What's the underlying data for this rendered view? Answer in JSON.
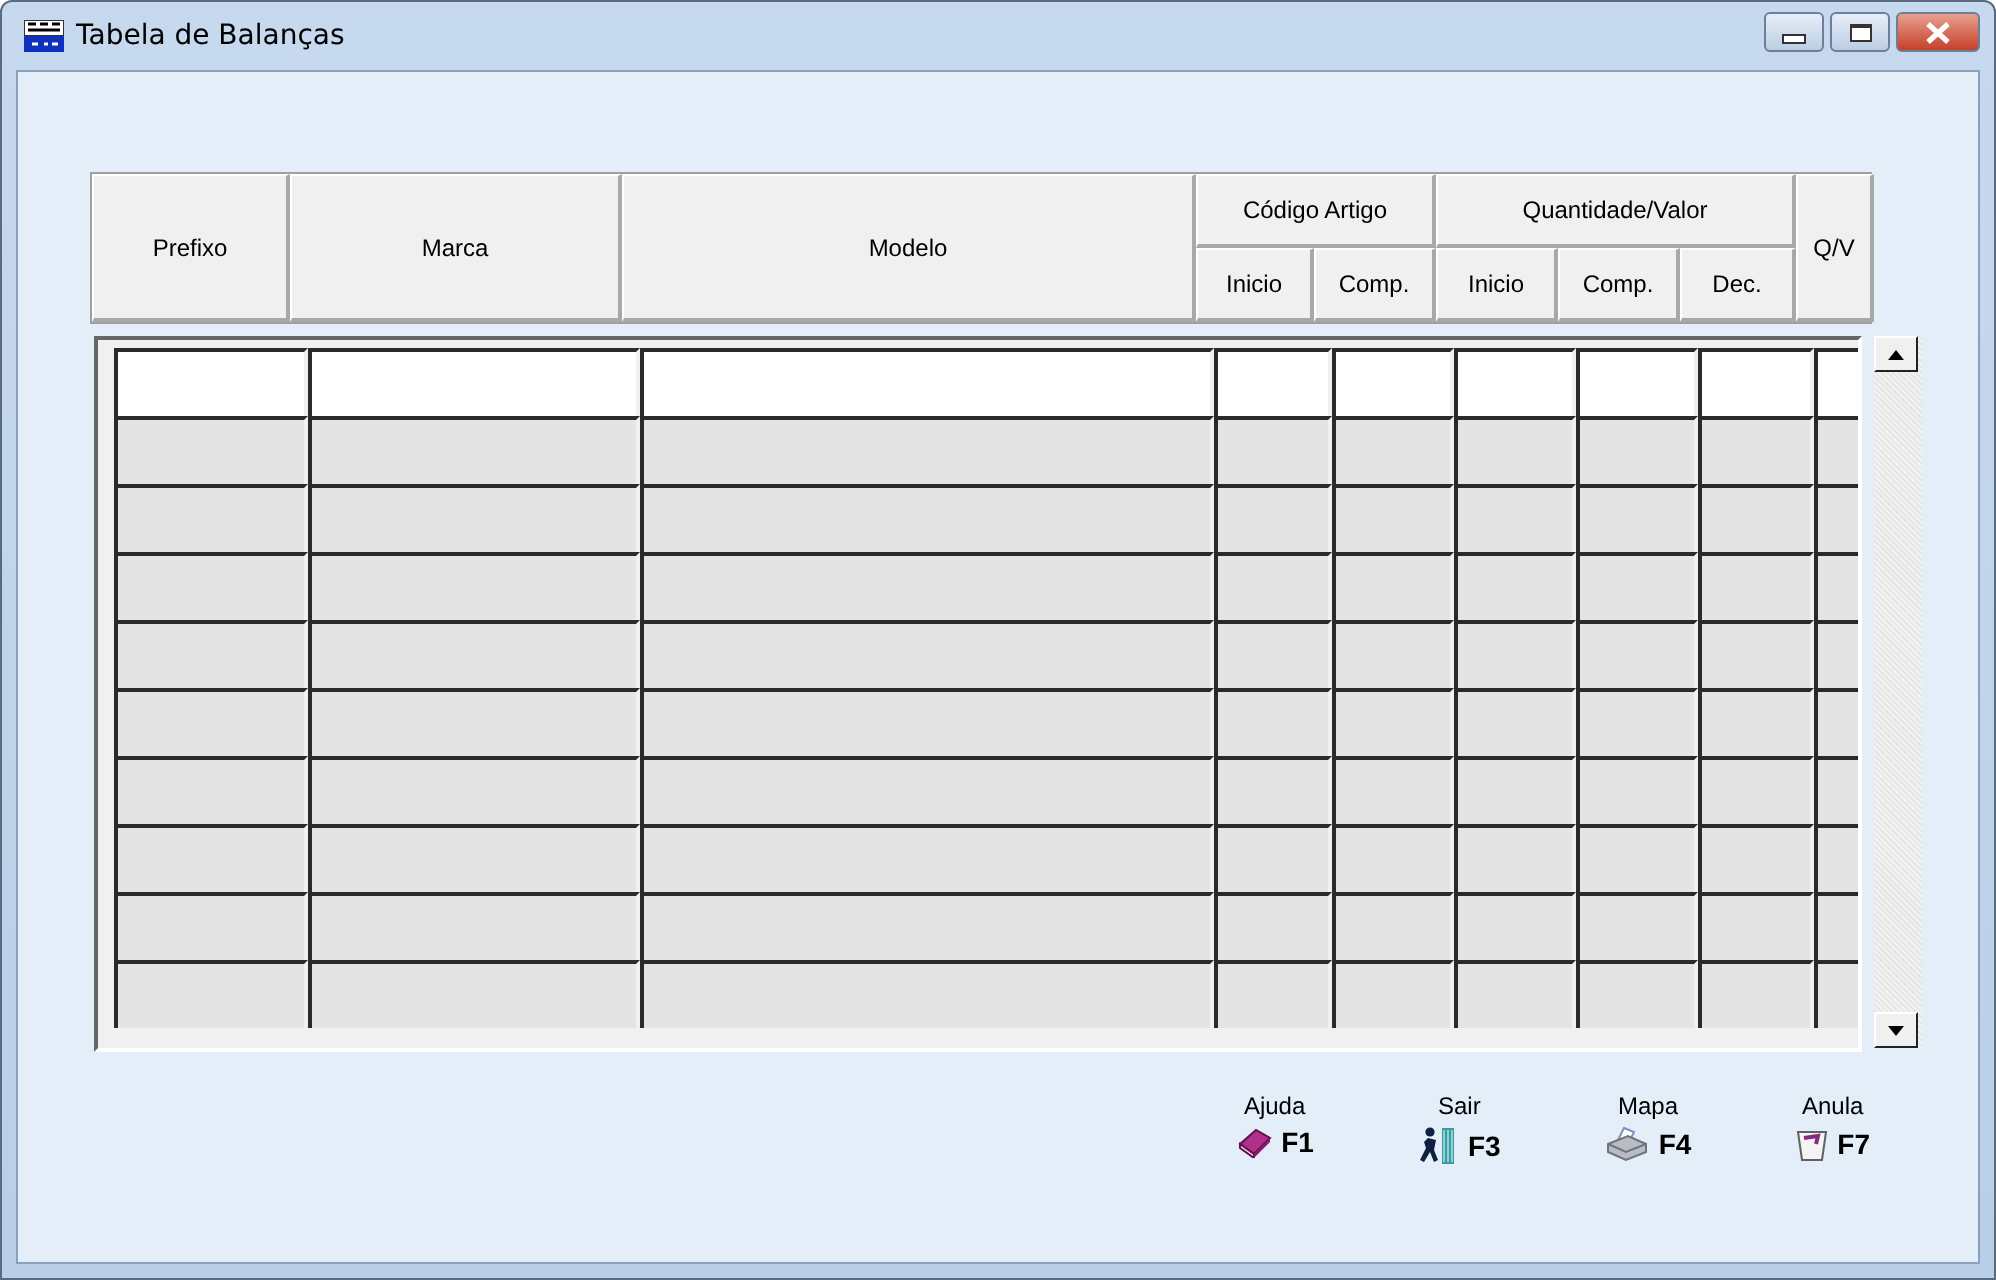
{
  "window": {
    "title": "Tabela de Balanças"
  },
  "table": {
    "columns": [
      {
        "label": "Prefixo"
      },
      {
        "label": "Marca"
      },
      {
        "label": "Modelo"
      },
      {
        "label": "Código Artigo",
        "children": [
          {
            "label": "Inicio"
          },
          {
            "label": "Comp."
          }
        ]
      },
      {
        "label": "Quantidade/Valor",
        "children": [
          {
            "label": "Inicio"
          },
          {
            "label": "Comp."
          },
          {
            "label": "Dec."
          }
        ]
      },
      {
        "label": "Q/V"
      }
    ],
    "rows": [
      {
        "selected": true
      },
      {
        "selected": false
      },
      {
        "selected": false
      },
      {
        "selected": false
      },
      {
        "selected": false
      },
      {
        "selected": false
      },
      {
        "selected": false
      },
      {
        "selected": false
      },
      {
        "selected": false
      },
      {
        "selected": false
      }
    ]
  },
  "actions": [
    {
      "label": "Ajuda",
      "key": "F1",
      "kind": "help"
    },
    {
      "label": "Sair",
      "key": "F3",
      "kind": "exit"
    },
    {
      "label": "Mapa",
      "key": "F4",
      "kind": "print"
    },
    {
      "label": "Anula",
      "key": "F7",
      "kind": "delete"
    }
  ]
}
